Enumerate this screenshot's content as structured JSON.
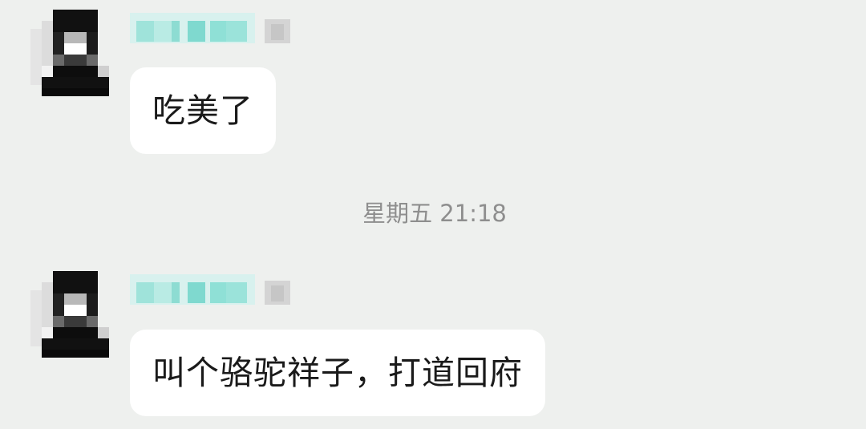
{
  "messages": [
    {
      "avatar_icon": "pixelated-avatar-icon",
      "sender_name_icon": "pixelated-name-icon",
      "text": "吃美了"
    },
    {
      "avatar_icon": "pixelated-avatar-icon",
      "sender_name_icon": "pixelated-name-icon",
      "text": "叫个骆驼祥子，打道回府"
    }
  ],
  "timestamp": "星期五 21:18",
  "colors": {
    "background": "#eef0ee",
    "bubble": "#ffffff",
    "name_tint": "#7fd9cf",
    "timestamp": "#8e8e8e"
  }
}
